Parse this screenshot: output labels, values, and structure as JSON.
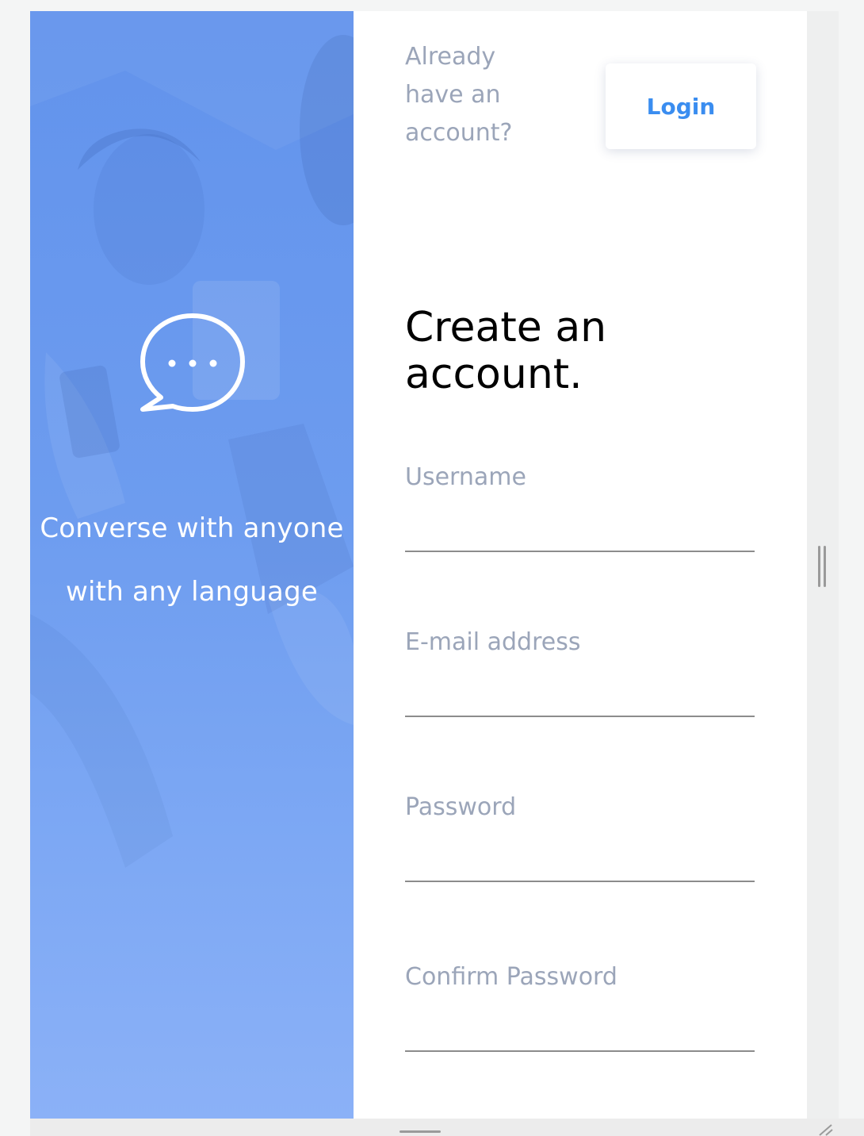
{
  "hero": {
    "tagline_line1": "Converse with anyone",
    "tagline_line2": "with any language",
    "icon": "chat-bubble-icon"
  },
  "header": {
    "prompt": "Already have an account?",
    "login_label": "Login"
  },
  "form": {
    "title": "Create an account.",
    "fields": [
      {
        "label": "Username",
        "value": ""
      },
      {
        "label": "E-mail address",
        "value": ""
      },
      {
        "label": "Password",
        "value": ""
      },
      {
        "label": "Confirm Password",
        "value": ""
      }
    ]
  },
  "colors": {
    "hero_gradient_top": "#6293ec",
    "hero_gradient_bottom": "#8bb1f7",
    "accent": "#3a8df0",
    "muted_text": "#9ba5b9",
    "title_text": "#000000"
  }
}
